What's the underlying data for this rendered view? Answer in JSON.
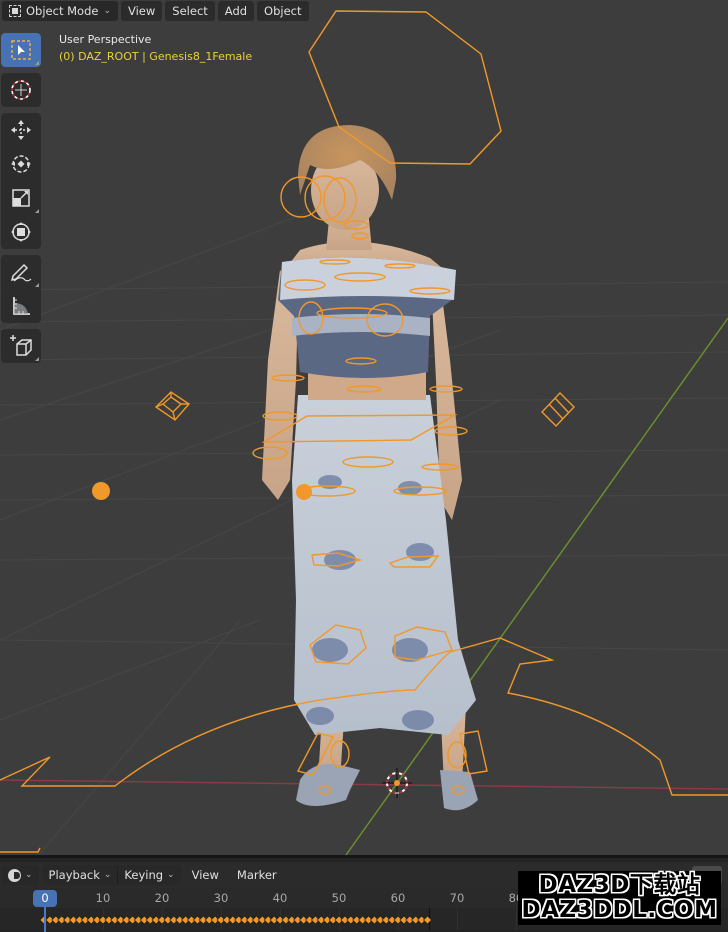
{
  "header": {
    "mode": "Object Mode",
    "menus": [
      "View",
      "Select",
      "Add",
      "Object"
    ]
  },
  "viewport": {
    "view_name": "User Perspective",
    "object_path": "(0) DAZ_ROOT | Genesis8_1Female"
  },
  "toolbar": {
    "tools": [
      {
        "name": "select-box",
        "icon": "select-box-icon",
        "active": true
      },
      {
        "name": "cursor",
        "icon": "cursor-icon"
      },
      {
        "name": "move",
        "icon": "move-icon"
      },
      {
        "name": "rotate",
        "icon": "rotate-icon"
      },
      {
        "name": "scale",
        "icon": "scale-icon"
      },
      {
        "name": "transform",
        "icon": "transform-icon"
      },
      {
        "name": "annotate",
        "icon": "annotate-icon"
      },
      {
        "name": "measure",
        "icon": "measure-icon"
      },
      {
        "name": "add-cube",
        "icon": "add-cube-icon"
      }
    ]
  },
  "timeline": {
    "editor_icon": "clock-icon",
    "menus": {
      "playback": "Playback",
      "keying": "Keying",
      "view": "View",
      "marker": "Marker"
    },
    "current_frame": "0",
    "ticks": [
      "10",
      "20",
      "30",
      "40",
      "50",
      "60",
      "70",
      "80"
    ],
    "keyframe_range": {
      "start": 0,
      "end": 65
    }
  },
  "colors": {
    "selection": "#f0982a",
    "active_tool": "#4772b3",
    "x_axis": "#8a3a46",
    "y_axis": "#6a8e2e",
    "info_text": "#e8d23a"
  },
  "watermark": {
    "line1": "DAZ3D下载站",
    "line2": "DAZ3DDL.COM"
  }
}
